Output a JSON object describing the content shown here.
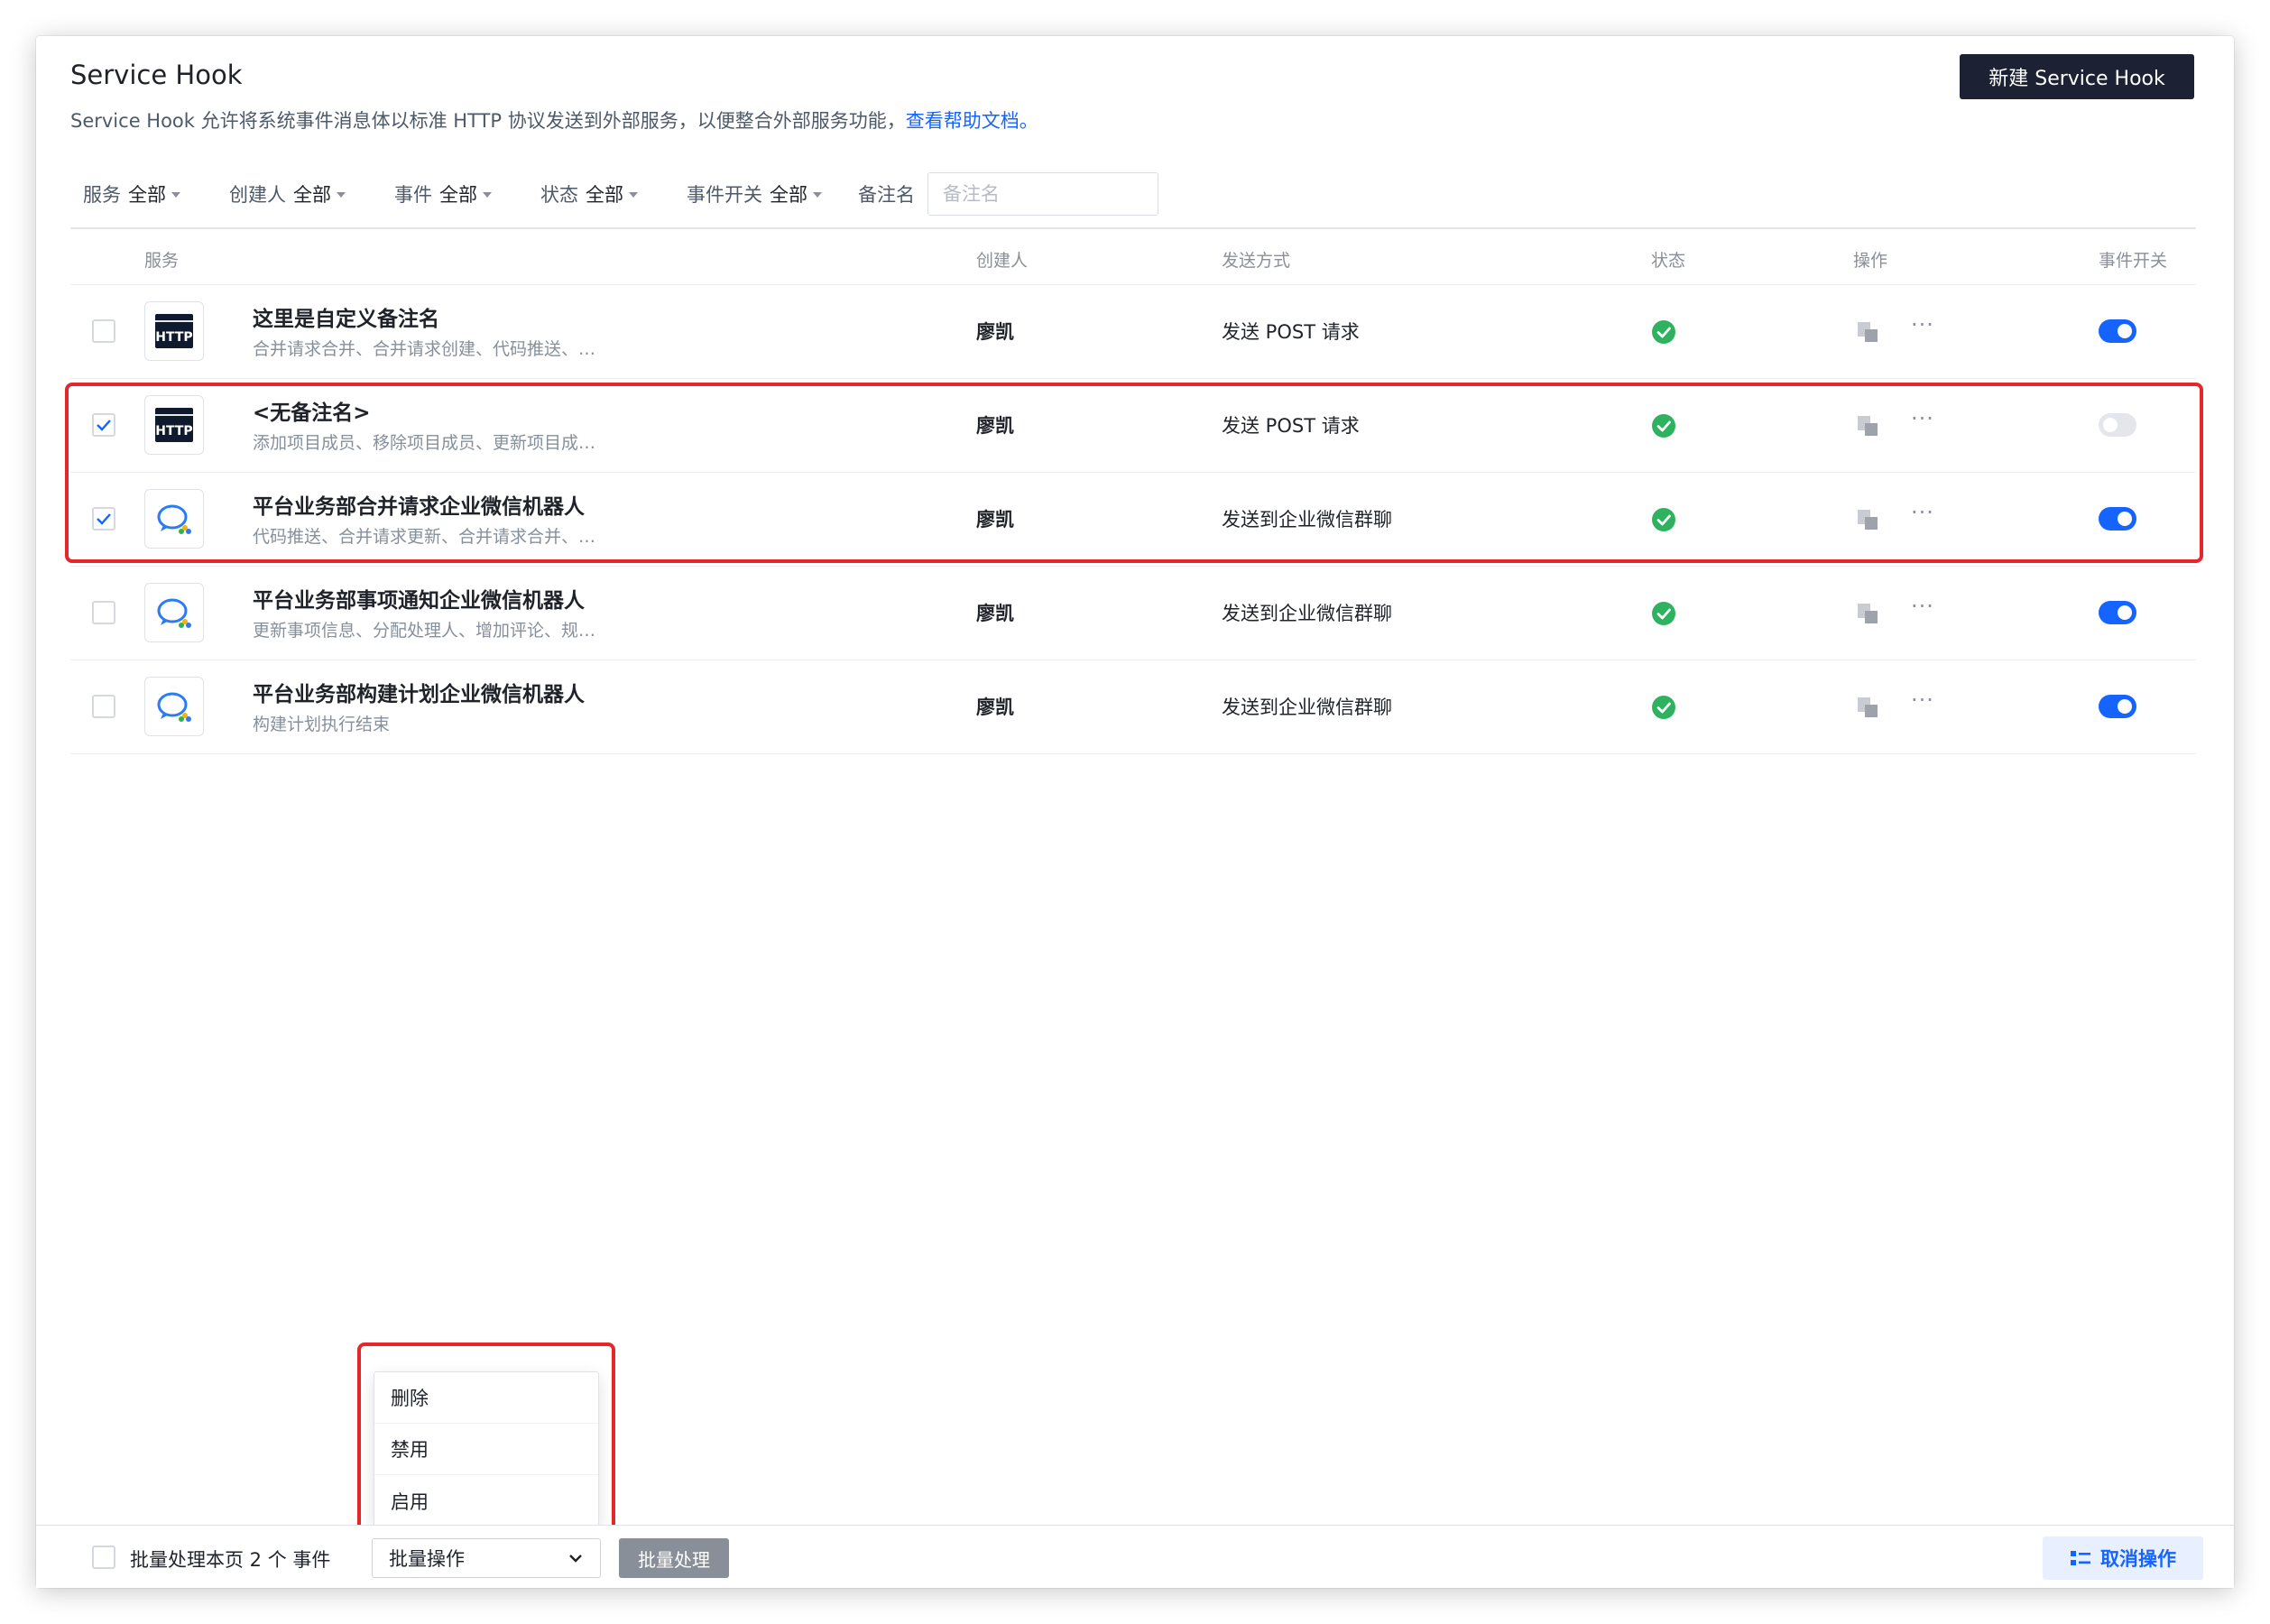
{
  "header": {
    "title": "Service Hook",
    "description": "Service Hook 允许将系统事件消息体以标准 HTTP 协议发送到外部服务，以便整合外部服务功能，",
    "help_link": "查看帮助文档。",
    "new_button": "新建 Service Hook"
  },
  "filters": [
    {
      "label": "服务",
      "value": "全部"
    },
    {
      "label": "创建人",
      "value": "全部"
    },
    {
      "label": "事件",
      "value": "全部"
    },
    {
      "label": "状态",
      "value": "全部"
    },
    {
      "label": "事件开关",
      "value": "全部"
    }
  ],
  "note_filter": {
    "label": "备注名",
    "placeholder": "备注名"
  },
  "columns": {
    "service": "服务",
    "creator": "创建人",
    "method": "发送方式",
    "status": "状态",
    "actions": "操作",
    "switch": "事件开关"
  },
  "rows": [
    {
      "checked": false,
      "icon": "http-icon",
      "name": "这里是自定义备注名",
      "events": "合并请求合并、合并请求创建、代码推送、…",
      "creator": "廖凯",
      "method": "发送 POST 请求",
      "status": "success",
      "enabled": true
    },
    {
      "checked": true,
      "icon": "http-icon",
      "name": "<无备注名>",
      "events": "添加项目成员、移除项目成员、更新项目成…",
      "creator": "廖凯",
      "method": "发送 POST 请求",
      "status": "success",
      "enabled": false
    },
    {
      "checked": true,
      "icon": "wecom-icon",
      "name": "平台业务部合并请求企业微信机器人",
      "events": "代码推送、合并请求更新、合并请求合并、…",
      "creator": "廖凯",
      "method": "发送到企业微信群聊",
      "status": "success",
      "enabled": true
    },
    {
      "checked": false,
      "icon": "wecom-icon",
      "name": "平台业务部事项通知企业微信机器人",
      "events": "更新事项信息、分配处理人、增加评论、规…",
      "creator": "廖凯",
      "method": "发送到企业微信群聊",
      "status": "success",
      "enabled": true
    },
    {
      "checked": false,
      "icon": "wecom-icon",
      "name": "平台业务部构建计划企业微信机器人",
      "events": "构建计划执行结束",
      "creator": "廖凯",
      "method": "发送到企业微信群聊",
      "status": "success",
      "enabled": true
    }
  ],
  "icons": {
    "http": "HTTP",
    "status": "check-circle-icon",
    "copy": "copy-icon",
    "more": "···"
  },
  "footer": {
    "select_text": "批量处理本页 2 个 事件",
    "bulk_select_value": "批量操作",
    "bulk_button": "批量处理",
    "cancel_button": "取消操作"
  },
  "dropdown": {
    "options": [
      "删除",
      "禁用",
      "启用"
    ]
  },
  "colors": {
    "accent": "#1664ff",
    "success": "#2fb260",
    "highlight": "#e5262a",
    "dark_button": "#1c2233"
  }
}
